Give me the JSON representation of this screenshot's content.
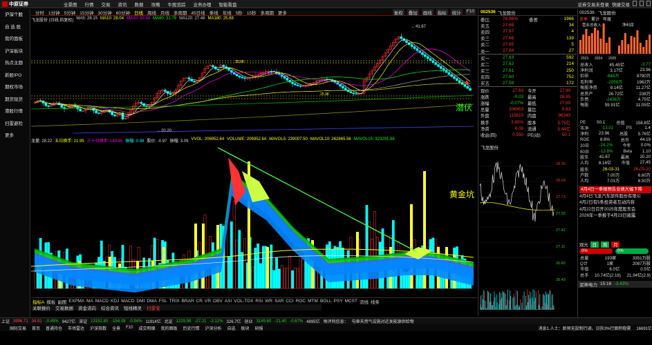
{
  "app": {
    "logo_text": "中原证券"
  },
  "top_menu": [
    "全景图",
    "行情",
    "交易",
    "资讯",
    "数据",
    "攻略",
    "牛股追踪",
    "业务办理",
    "智能看盘"
  ],
  "top_right": [
    "证券交易未登录",
    "快捷交易"
  ],
  "sidebar": [
    {
      "label": "沪深个股",
      "active": true
    },
    {
      "label": "自 选 股",
      "active": false
    },
    {
      "label": "我的面板",
      "active": false
    },
    {
      "label": "沪深板块",
      "active": false
    },
    {
      "label": "热点主题",
      "active": false
    },
    {
      "label": "新股IPO",
      "active": false
    },
    {
      "label": "期权市场",
      "active": false
    },
    {
      "label": "期货现货",
      "active": false
    },
    {
      "label": "港股行情",
      "active": false
    },
    {
      "label": "扫雷避险",
      "active": false
    },
    {
      "label": "更多",
      "active": false
    }
  ],
  "period_tabs": [
    "分时",
    "1分钟",
    "5分钟",
    "15分钟",
    "30分钟",
    "60分钟",
    "日线",
    "周线",
    "月线",
    "多周期",
    "45日线",
    "季线",
    "年线",
    "5秒",
    "15秒",
    "多周期",
    "更多"
  ],
  "period_selected": "日线",
  "toolbar_right": [
    "复权",
    "叠加",
    "画线",
    "指标",
    "统计",
    "F10"
  ],
  "chart_title": "飞龙股份 (日线,前复权)",
  "ma_legend": [
    {
      "label": "MA5: 28.15",
      "color": "#ddd"
    },
    {
      "label": "MA10: 28.04",
      "color": "#ff0"
    },
    {
      "label": "MA20: 32.34",
      "color": "#f0f"
    },
    {
      "label": "MA60: 31.79",
      "color": "#0f0"
    },
    {
      "label": "MA120: 27.48",
      "color": "#ccc"
    },
    {
      "label": "MA180: 25.88",
      "color": "#ff0"
    }
  ],
  "indicator_legend": [
    {
      "label": "龙量: 28.22",
      "color": "#ddd"
    },
    {
      "label": "五日换手: 21.95",
      "color": "#ff0"
    },
    {
      "label": "三十日换手: 149.85",
      "color": "#f0f"
    },
    {
      "label": "振幅: 0.98",
      "color": "#0ff"
    },
    {
      "label": "股价: -0.97",
      "color": "#ddd"
    },
    {
      "label": "振幅: 3.09",
      "color": "#ddd"
    },
    {
      "label": "VVOL: 206952.64",
      "color": "#ff0"
    },
    {
      "label": "VOLUME: 206952.64",
      "color": "#ff0"
    },
    {
      "label": "MAVOL5: 239007.50",
      "color": "#ff0"
    },
    {
      "label": "MAVOL10: 262865.56",
      "color": "#ff0"
    },
    {
      "label": "MAVOL15: 323291.88",
      "color": "#0f0"
    }
  ],
  "annotations": {
    "high": "41.67",
    "low": "20.20",
    "level1": "35.68",
    "level2": "25.98",
    "qianfu": "潜伏",
    "huangjinkeng": "黄金坑",
    "t6": "6",
    "t4": "4"
  },
  "indicator_tabs": [
    "指标A",
    "模板",
    "副图",
    "EXPMA",
    "MA",
    "MACD",
    "KDJ",
    "MACD",
    "DMI",
    "DMA",
    "FSL",
    "TRIX",
    "BRAR",
    "CR",
    "VR",
    "OBV",
    "ASI",
    "VOL-TDX",
    "RSI",
    "WR",
    "SAR",
    "CCI",
    "ROC",
    "MTM",
    "BOLL",
    "PSY",
    "MCST",
    "流线",
    "线条"
  ],
  "indicator_selected": "指标A",
  "bottom_tabs": [
    "关联报价",
    "交易数据",
    "资金流向",
    "综合资讯",
    "短线精灵",
    "扫雷宝"
  ],
  "bottom_selected": "扫雷宝",
  "quote": {
    "code": "002536",
    "name": "飞龙股份",
    "webi": "78.96%",
    "webi_label": "委比",
    "wecha_label": "委差",
    "wecha": "1966",
    "sells": [
      {
        "label": "卖五",
        "price": "27.68",
        "vol": "34"
      },
      {
        "label": "卖四",
        "price": "27.67",
        "vol": "4"
      },
      {
        "label": "卖三",
        "price": "27.66",
        "vol": "139"
      },
      {
        "label": "卖二",
        "price": "27.65",
        "vol": "5"
      },
      {
        "label": "卖一",
        "price": "27.64",
        "vol": "27"
      }
    ],
    "buys": [
      {
        "label": "买一",
        "price": "27.63",
        "vol": "592"
      },
      {
        "label": "买二",
        "price": "27.62",
        "vol": "214"
      },
      {
        "label": "买三",
        "price": "27.61",
        "vol": "250"
      },
      {
        "label": "买四",
        "price": "27.60",
        "vol": "752"
      },
      {
        "label": "买五",
        "price": "27.59",
        "vol": "172"
      }
    ],
    "stats": [
      {
        "k": "现价",
        "v": "27.63",
        "k2": "今开",
        "v2": "27.90"
      },
      {
        "k": "涨跌",
        "v": "-0.03",
        "k2": "最高",
        "v2": "28.35"
      },
      {
        "k": "涨幅",
        "v": "-0.07%",
        "k2": "最低",
        "v2": "27.50"
      },
      {
        "k": "总量",
        "v": "206953",
        "k2": "量比",
        "v2": "0.83"
      },
      {
        "k": "外盘",
        "v": "110610",
        "k2": "内盘",
        "v2": "96343"
      },
      {
        "k": "换手",
        "v": "3.80%",
        "k2": "股本",
        "v2": "5.75亿"
      },
      {
        "k": "净资",
        "v": "6.08",
        "k2": "流通",
        "v2": "5.44亿"
      },
      {
        "k": "收益(四)",
        "v": "0.550",
        "k2": "PE(动)",
        "v2": "50.1"
      }
    ]
  },
  "mini_chart": {
    "title": "飞龙股份",
    "y_labels": [
      "28.35",
      "28.04",
      "27.73",
      "27.55",
      "27.42",
      "27.11",
      "26.80",
      "26.49"
    ]
  },
  "fin": {
    "code": "002536",
    "name": "飞龙股份",
    "tabs": [
      "单季",
      "累计",
      "年度"
    ],
    "tab_selected": "单季",
    "chart_labels": [
      "营业总收入",
      "净利润"
    ],
    "years": [
      "2023",
      "2024",
      "2025"
    ],
    "rows": [
      {
        "k": "总收入",
        "v": "45.45亿",
        "k2": "同比",
        "v2": "-3.77"
      },
      {
        "k": "净利润",
        "v": "3.17亿",
        "k2": "同比",
        "v2": "23.96"
      },
      {
        "k": "扣非",
        "v": "-846万",
        "k2": "同比",
        "v2": "8790万"
      },
      {
        "k": "毛利率",
        "v": "-2059万",
        "k2": "",
        "v2": "1962万"
      },
      {
        "k": "每股净资",
        "v": "9.14亿",
        "k2": "",
        "v2": "11.27亿"
      },
      {
        "k": "总资产",
        "v": "26.72亿",
        "k2": "",
        "v2": "238万"
      },
      {
        "k": "负债",
        "v": "-2436万",
        "k2": "",
        "v2": "4.75亿"
      },
      {
        "k": "每股",
        "v": "59.91亿",
        "k2": "",
        "v2": "11.05亿"
      }
    ],
    "kv": [
      {
        "k": "PE",
        "v": "50.1",
        "k2": "总值",
        "v2": "158.8亿"
      },
      {
        "k": "市净",
        "v": "-13.01",
        "k2": "PS",
        "v2": "1.4"
      },
      {
        "k": "净利",
        "v": "23.96",
        "k2": "总股",
        "v2": "5.76亿"
      },
      {
        "k": "ROE",
        "v": "8.8%",
        "k2": "总市",
        "v2": "44.19"
      },
      {
        "k": "20日",
        "v": "-24.2%",
        "k2": "今年",
        "v2": "0.0%"
      },
      {
        "k": "60日",
        "v": "-13.8%",
        "k2": "Beta",
        "v2": "1.10"
      },
      {
        "k": "股东",
        "v": "41.67",
        "k2": "最高",
        "v2": "20.20"
      },
      {
        "k": "人均",
        "v": "8.16亿",
        "k2": "市值",
        "v2": "27.45"
      }
    ],
    "date1": "26-03-31",
    "date2": "26-03-20",
    "holders": [
      {
        "k": "户数",
        "v": "7.00万",
        "v2": "6.60万"
      },
      {
        "k": "人均",
        "v": "7.01万",
        "v2": "8.50万"
      }
    ],
    "news_headline": "4月4日一季报预告业绩大幅下降",
    "news": [
      "4月4日飞龙汽车部件股份有限公",
      "4月2日有5条投资者互动内容",
      "4月22日召开2025年度股东会",
      "2026年一季报于4月23日披露"
    ]
  },
  "trade": {
    "label_buy": "观光",
    "tabs": [
      "日",
      "周",
      "月"
    ],
    "limit_up": "0%",
    "limit_down": "0%",
    "rows": [
      {
        "k": "总量",
        "v": "193家",
        "k2": "外盘",
        "v2": "3351万股"
      },
      {
        "k": "Q计",
        "v": "1家",
        "k2": "外盘",
        "v2": "2087万股"
      },
      {
        "k": "市值",
        "v": "6.0亿",
        "k2": "",
        "v2": "0.5亿"
      },
      {
        "k": "总手",
        "v": "10.74亿(2.18)",
        "k2": "",
        "v2": "21.94亿(2.9)"
      }
    ],
    "sector": "泥神电力",
    "sector_time": "15:16",
    "sector_change": "-3.43%"
  },
  "status": {
    "items": [
      {
        "t": "上证",
        "c": "w"
      },
      {
        "t": "3996.71",
        "c": "r"
      },
      {
        "t": "34.91",
        "c": "r"
      },
      {
        "t": "-0.49%",
        "c": "g"
      },
      {
        "t": "9427亿",
        "c": "w"
      },
      {
        "t": "深证",
        "c": "w"
      },
      {
        "t": "13152.80",
        "c": "g"
      },
      {
        "t": "-154.08",
        "c": "g"
      },
      {
        "t": "-0.94%",
        "c": "g"
      },
      {
        "t": "11914亿",
        "c": "w"
      },
      {
        "t": "北证",
        "c": "w"
      },
      {
        "t": "1229.98",
        "c": "g"
      },
      {
        "t": "-27.21",
        "c": "g"
      },
      {
        "t": "-2.12%",
        "c": "g"
      },
      {
        "t": "326.7亿",
        "c": "w"
      },
      {
        "t": "创业",
        "c": "w"
      },
      {
        "t": "3149.60",
        "c": "g"
      },
      {
        "t": "-21.40",
        "c": "g"
      },
      {
        "t": "-0.67%",
        "c": "g"
      },
      {
        "t": "4895亿",
        "c": "w"
      },
      {
        "t": "每评利信息：",
        "c": "w"
      },
      {
        "t": "句章天然气设施对近发能源供给物",
        "c": "w"
      }
    ],
    "bottom": [
      "国际交易",
      "首页",
      "普通持仓",
      "市场雷达",
      "沪深指数",
      "全景",
      "F10",
      "成交明细",
      "我的面板",
      "历史行情",
      "沪深分析",
      "自选",
      "板块",
      "研报"
    ],
    "bottom_right": "消息1.人士：龄预无投制行调，日拆3%行面积稳需",
    "clock": "16691亿"
  }
}
